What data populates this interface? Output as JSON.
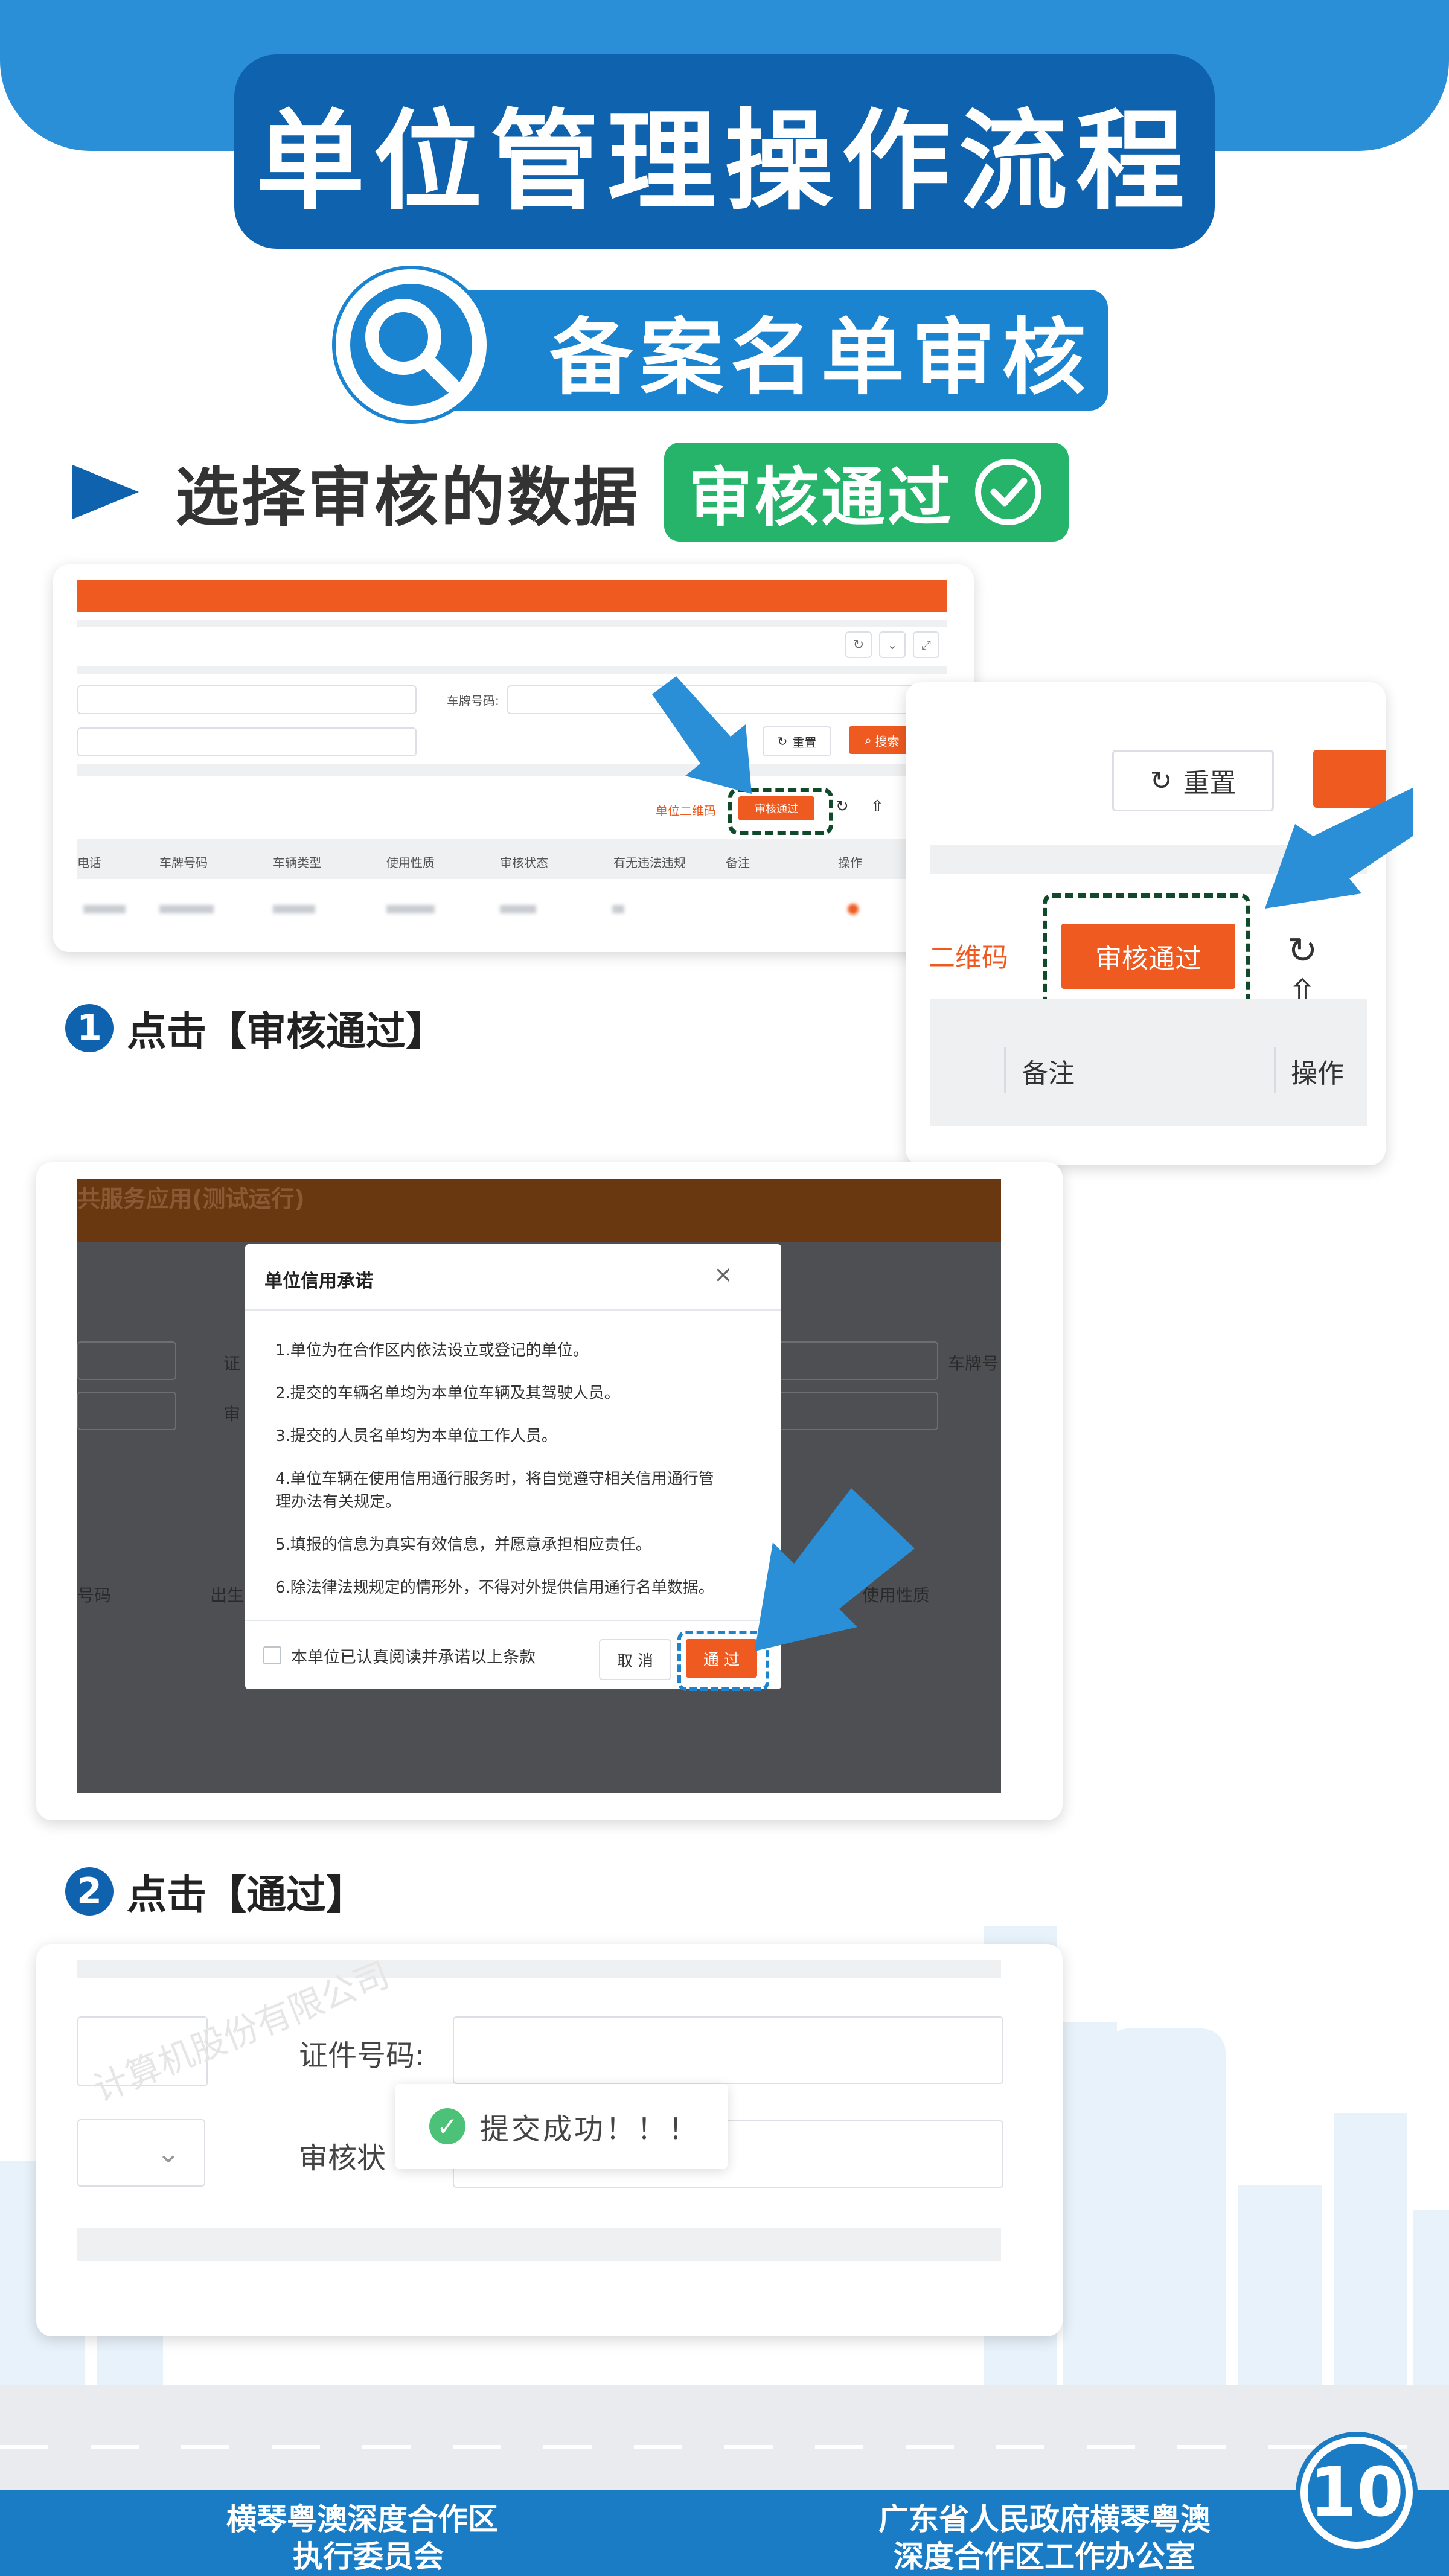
{
  "header": {
    "title": "单位管理操作流程",
    "subtitle": "备案名单审核"
  },
  "step_heading": {
    "text": "选择审核的数据",
    "badge": "审核通过"
  },
  "screen1": {
    "plate_label": "车牌号码:",
    "reset_label": "重置",
    "search_label": "搜索",
    "qrcode_label": "单位二维码",
    "approve_label": "审核通过",
    "columns": [
      "电话",
      "车牌号码",
      "车辆类型",
      "使用性质",
      "审核状态",
      "有无违法违规",
      "备注",
      "操作"
    ]
  },
  "zoom": {
    "reset_label": "重置",
    "qrcode_label": "二维码",
    "approve_label": "审核通过",
    "col_remark": "备注",
    "col_action": "操作"
  },
  "caption1": {
    "num": "1",
    "text": "点击【审核通过】"
  },
  "modal": {
    "bg_title": "共服务应用(测试运行)",
    "bg_label_cert": "证",
    "bg_label_audit": "审",
    "bg_label_plate": "车牌号",
    "bg_label_num": "号码",
    "bg_label_birth": "出生",
    "bg_label_use": "使用性质",
    "title": "单位信用承诺",
    "lines": [
      "1.单位为在合作区内依法设立或登记的单位。",
      "2.提交的车辆名单均为本单位车辆及其驾驶人员。",
      "3.提交的人员名单均为本单位工作人员。",
      "4.单位车辆在使用信用通行服务时，将自觉遵守相关信用通行管",
      "理办法有关规定。",
      "5.填报的信息为真实有效信息，并愿意承担相应责任。",
      "6.除法律法规规定的情形外，不得对外提供信用通行名单数据。"
    ],
    "agree_text": "本单位已认真阅读并承诺以上条款",
    "cancel_label": "取 消",
    "pass_label": "通 过"
  },
  "caption2": {
    "num": "2",
    "text": "点击【通过】"
  },
  "screen3": {
    "cert_label": "证件号码:",
    "audit_label": "审核状",
    "toast": "提交成功！！！",
    "watermark": "计算机股份有限公司"
  },
  "footer": {
    "left_line1": "横琴粤澳深度合作区",
    "left_line2": "执行委员会",
    "right_line1": "广东省人民政府横琴粤澳",
    "right_line2": "深度合作区工作办公室",
    "page_number": "10"
  },
  "colors": {
    "brand_blue": "#0f62ad",
    "light_blue": "#1b84d0",
    "accent_orange": "#ee5a1f",
    "success_green": "#25b46a"
  }
}
